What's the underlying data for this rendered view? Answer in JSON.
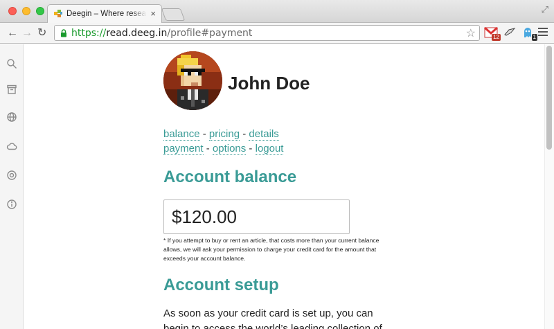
{
  "browser": {
    "tab_title": "Deegin – Where research g",
    "url_scheme": "https://",
    "url_host": "read.deeg.in",
    "url_path": "/profile#payment",
    "extensions": [
      {
        "name": "gmail-extension",
        "badge": "12"
      },
      {
        "name": "bird-extension",
        "badge": ""
      },
      {
        "name": "ghost-extension",
        "badge": "1"
      }
    ]
  },
  "rail": {
    "items": [
      "search-icon",
      "archive-icon",
      "globe-icon",
      "cloud-icon",
      "help-icon",
      "info-icon"
    ]
  },
  "profile": {
    "name": "John Doe"
  },
  "nav": {
    "balance": "balance",
    "pricing": "pricing",
    "details": "details",
    "payment": "payment",
    "options": "options",
    "logout": "logout",
    "separator": " - "
  },
  "account_balance": {
    "heading": "Account balance",
    "value": "$120.00",
    "note": "* If you attempt to buy or rent an article, that costs more than your current balance allows, we will ask your permission to charge your credit card for the amount that exceeds your account balance."
  },
  "account_setup": {
    "heading": "Account setup",
    "paragraph": "As soon as your credit card is set up, you can begin to access the world’s leading collection of"
  },
  "colors": {
    "accent": "#3a9b96",
    "url_secure": "#1a9a2d"
  }
}
